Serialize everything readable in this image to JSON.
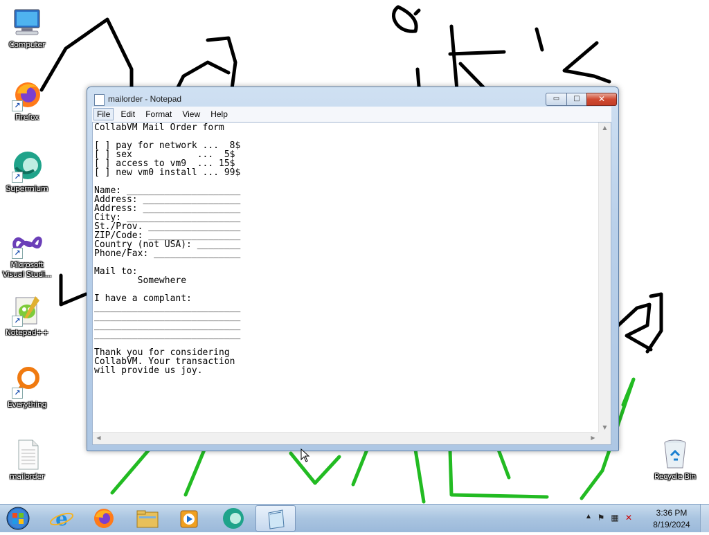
{
  "desktop": {
    "icons": [
      {
        "label": "Computer",
        "icon": "computer-icon"
      },
      {
        "label": "Firefox",
        "icon": "firefox-icon"
      },
      {
        "label": "Supermium",
        "icon": "supermium-icon"
      },
      {
        "label": "Microsoft Visual Studi...",
        "icon": "visual-studio-icon"
      },
      {
        "label": "Notepad++",
        "icon": "notepad-plus-plus-icon"
      },
      {
        "label": "Everything",
        "icon": "everything-icon"
      },
      {
        "label": "mailorder",
        "icon": "text-file-icon"
      },
      {
        "label": "Recycle Bin",
        "icon": "recycle-bin-icon"
      }
    ]
  },
  "window": {
    "title": "mailorder - Notepad",
    "controls": {
      "minimize": "▭",
      "maximize": "□",
      "close": "✕"
    }
  },
  "menu": {
    "file": "File",
    "edit": "Edit",
    "format": "Format",
    "view": "View",
    "help": "Help"
  },
  "document": {
    "content": "CollabVM Mail Order form\n\n[ ] pay for network ...  8$\n[ ] sex            ...  5$\n[ ] access to vm9  ... 15$\n[ ] new vm0 install ... 99$\n\nName: _____________________\nAddress: __________________\nAddress: __________________\nCity: _____________________\nSt./Prov. _________________\nZIP/Code: _________________\nCountry (not USA): ________\nPhone/Fax: ________________\n\nMail to:\n        Somewhere\n\nI have a complant:\n___________________________\n___________________________\n___________________________\n___________________________\n\nThank you for considering\nCollabVM. Your transaction\nwill provide us joy."
  },
  "taskbar": {
    "start": "start-orb-icon",
    "pinned": [
      "internet-explorer-icon",
      "firefox-icon",
      "file-explorer-icon",
      "media-player-icon",
      "supermium-icon",
      "notepad-icon"
    ],
    "tray": {
      "show_hidden": "▲",
      "clock_time": "3:36 PM",
      "clock_date": "8/19/2024"
    }
  },
  "colors": {
    "ink_black": "#000000",
    "ink_green": "#22bb22",
    "taskbar": "#a9c4e0",
    "window_frame": "#b9d0ea"
  }
}
